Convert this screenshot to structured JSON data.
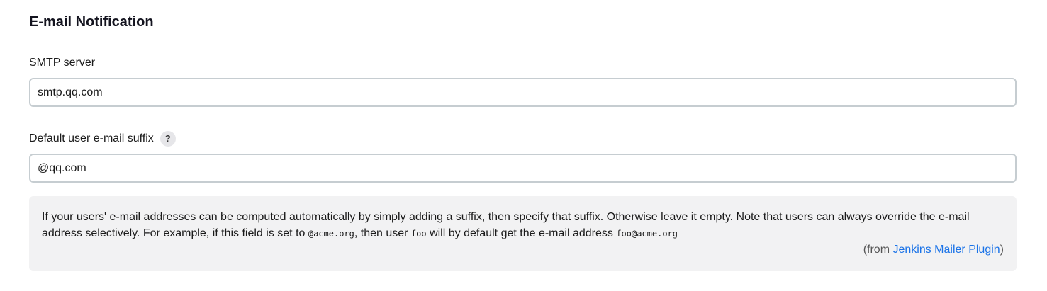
{
  "section": {
    "title": "E-mail Notification"
  },
  "smtp": {
    "label": "SMTP server",
    "value": "smtp.qq.com"
  },
  "suffix": {
    "label": "Default user e-mail suffix",
    "help_icon": "?",
    "value": "@qq.com"
  },
  "help": {
    "text_1": "If your users' e-mail addresses can be computed automatically by simply adding a suffix, then specify that suffix. Otherwise leave it empty. Note that users can always override the e-mail address selectively. For example, if this field is set to ",
    "code_1": "@acme.org",
    "text_2": ", then user ",
    "code_2": "foo",
    "text_3": " will by default get the e-mail address ",
    "code_3": "foo@acme.org",
    "from_prefix": "(from ",
    "from_link": "Jenkins Mailer Plugin",
    "from_suffix": ")"
  }
}
